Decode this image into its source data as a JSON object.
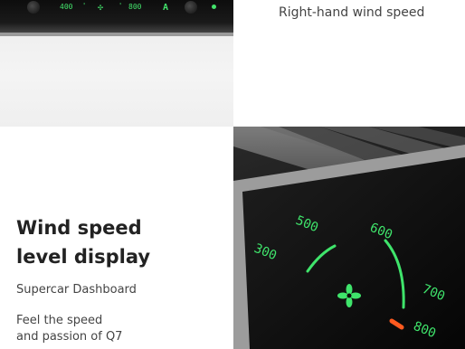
{
  "top_left": {
    "scale_labels": [
      "400",
      "800"
    ],
    "mode_letter": "A"
  },
  "caption": "Right-hand wind speed",
  "heading_line1": "Wind speed",
  "heading_line2": "level display",
  "subtitle": "Supercar Dashboard",
  "description_line1": "Feel the speed",
  "description_line2": "and passion of Q7",
  "dashboard": {
    "labels": [
      "300",
      "500",
      "600",
      "700",
      "800"
    ],
    "accent_green": "#3fe46b",
    "accent_orange": "#ff5a1f"
  }
}
